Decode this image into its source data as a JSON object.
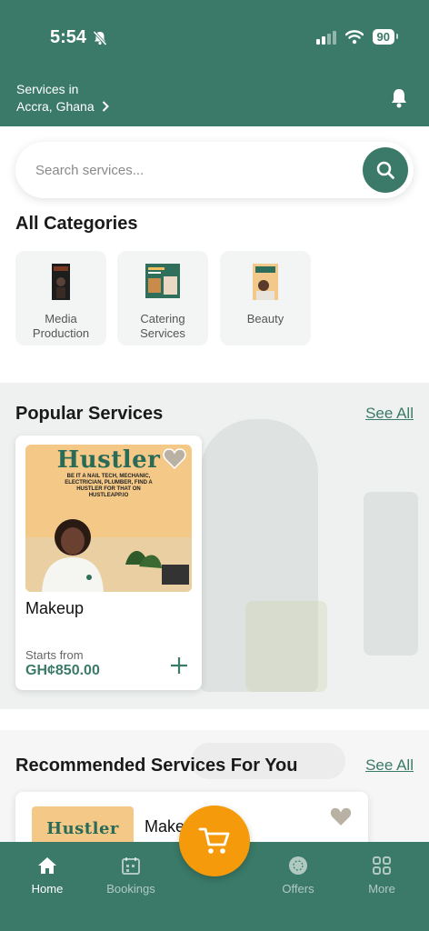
{
  "status_bar": {
    "time": "5:54",
    "battery": "90"
  },
  "location": {
    "label": "Services in",
    "value": "Accra, Ghana"
  },
  "search": {
    "placeholder": "Search services..."
  },
  "categories": {
    "title": "All Categories",
    "items": [
      {
        "label": "Media Production"
      },
      {
        "label": "Catering Services"
      },
      {
        "label": "Beauty"
      }
    ]
  },
  "popular": {
    "title": "Popular Services",
    "see_all": "See All",
    "card": {
      "poster_title": "Hustler",
      "poster_text": "BE IT A NAIL TECH, MECHANIC, ELECTRICIAN, PLUMBER, FIND A HUSTLER FOR THAT ON HUSTLEAPP.IO",
      "title": "Makeup",
      "starts_from": "Starts from",
      "price": "GH¢850.00"
    }
  },
  "recommended": {
    "title": "Recommended Services For You",
    "see_all": "See All",
    "card": {
      "poster_title": "Hustler",
      "title": "Make"
    }
  },
  "tabs": [
    {
      "label": "Home",
      "icon": "home-icon",
      "active": true
    },
    {
      "label": "Bookings",
      "icon": "calendar-icon"
    },
    {
      "label": "Offers",
      "icon": "offers-icon"
    },
    {
      "label": "More",
      "icon": "grid-icon"
    }
  ],
  "colors": {
    "primary": "#3b7a68",
    "accent": "#f59b0b"
  }
}
